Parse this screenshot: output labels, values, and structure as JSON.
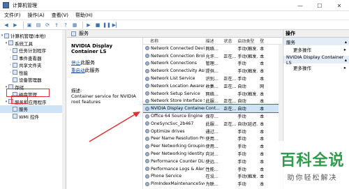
{
  "window": {
    "title": "计算机管理",
    "min": "—",
    "max": "☐",
    "close": "✕"
  },
  "menu": [
    "文件(F)",
    "操作(A)",
    "查看(V)",
    "帮助(H)"
  ],
  "tree": [
    {
      "label": "计算机管理(本地)",
      "indent": 0,
      "tog": "▾"
    },
    {
      "label": "系统工具",
      "indent": 1,
      "tog": "▾"
    },
    {
      "label": "任务计划程序",
      "indent": 2,
      "tog": "›"
    },
    {
      "label": "事件查看器",
      "indent": 2,
      "tog": "›"
    },
    {
      "label": "共享文件夹",
      "indent": 2,
      "tog": "›"
    },
    {
      "label": "性能",
      "indent": 2,
      "tog": "›"
    },
    {
      "label": "设备管理器",
      "indent": 2,
      "tog": ""
    },
    {
      "label": "存储",
      "indent": 1,
      "tog": "▾"
    },
    {
      "label": "磁盘管理",
      "indent": 2,
      "tog": ""
    },
    {
      "label": "服务和应用程序",
      "indent": 1,
      "tog": "▾"
    },
    {
      "label": "服务",
      "indent": 2,
      "tog": ""
    },
    {
      "label": "WMI 控件",
      "indent": 2,
      "tog": ""
    }
  ],
  "center": {
    "header": "服务",
    "service_name": "NVIDIA Display Container LS",
    "stop_link": "停止",
    "stop_suffix": "此服务",
    "restart_link": "重启动",
    "restart_suffix": "此服务",
    "desc_label": "描述:",
    "desc_text": "Container service for NVIDIA root features"
  },
  "list": {
    "headers": [
      "名称",
      "描述",
      "状态",
      "启动类型",
      "登"
    ],
    "rows": [
      [
        "Network Connected Devic...",
        "网络...",
        "",
        "手动(触发...",
        "本"
      ],
      [
        "Network Connection Broker",
        "允许...",
        "正在...",
        "手动(触发...",
        "本"
      ],
      [
        "Network Connections",
        "管理...",
        "",
        "手动",
        "本"
      ],
      [
        "Network Connectivity Assis...",
        "提供...",
        "",
        "手动(触发...",
        "本"
      ],
      [
        "Network List Service",
        "识别...",
        "正在...",
        "手动",
        "本"
      ],
      [
        "Network Location Awarene...",
        "收集...",
        "正在...",
        "自动",
        "网"
      ],
      [
        "Network Setup Service",
        "网络...",
        "",
        "手动(触发...",
        "本"
      ],
      [
        "Network Store Interface Se...",
        "此服...",
        "正在...",
        "自动",
        "本"
      ],
      [
        "NVIDIA Display Container LS",
        "Cont...",
        "正在...",
        "自动",
        "本"
      ],
      [
        "Office 64 Source Engine",
        "保存...",
        "",
        "手动",
        "本"
      ],
      [
        "OneSyncSvc_2b467",
        "此服...",
        "正在...",
        "自动(延迟...",
        "本"
      ],
      [
        "Optimize drives",
        "通过...",
        "",
        "手动",
        "本"
      ],
      [
        "Peer Name Resolution Pro...",
        "使用...",
        "",
        "手动",
        "本"
      ],
      [
        "Peer Networking Grouping",
        "使用...",
        "",
        "手动",
        "本"
      ],
      [
        "Peer Networking Identity ...",
        "向对...",
        "",
        "手动",
        "本"
      ],
      [
        "Performance Counter DLL ...",
        "使远...",
        "",
        "手动",
        "本"
      ],
      [
        "Performance Logs & Alerts",
        "性能...",
        "",
        "手动",
        "本"
      ],
      [
        "Phone Service",
        "在设...",
        "",
        "手动(触发...",
        "本"
      ],
      [
        "PimIndexMaintenanceSvc_...",
        "为联...",
        "",
        "手动",
        "本"
      ]
    ],
    "selected_index": 8
  },
  "actions": {
    "header": "操作",
    "section1": "服务",
    "more1": "更多操作",
    "section2": "NVIDIA Display Container LS",
    "more2": "更多操作"
  },
  "watermark": {
    "big": "百科全说",
    "small": "助你轻松解决"
  },
  "colors": {
    "highlight": "#e03030",
    "selection": "#cfe3f7",
    "watermark": "#2e9c4a"
  }
}
